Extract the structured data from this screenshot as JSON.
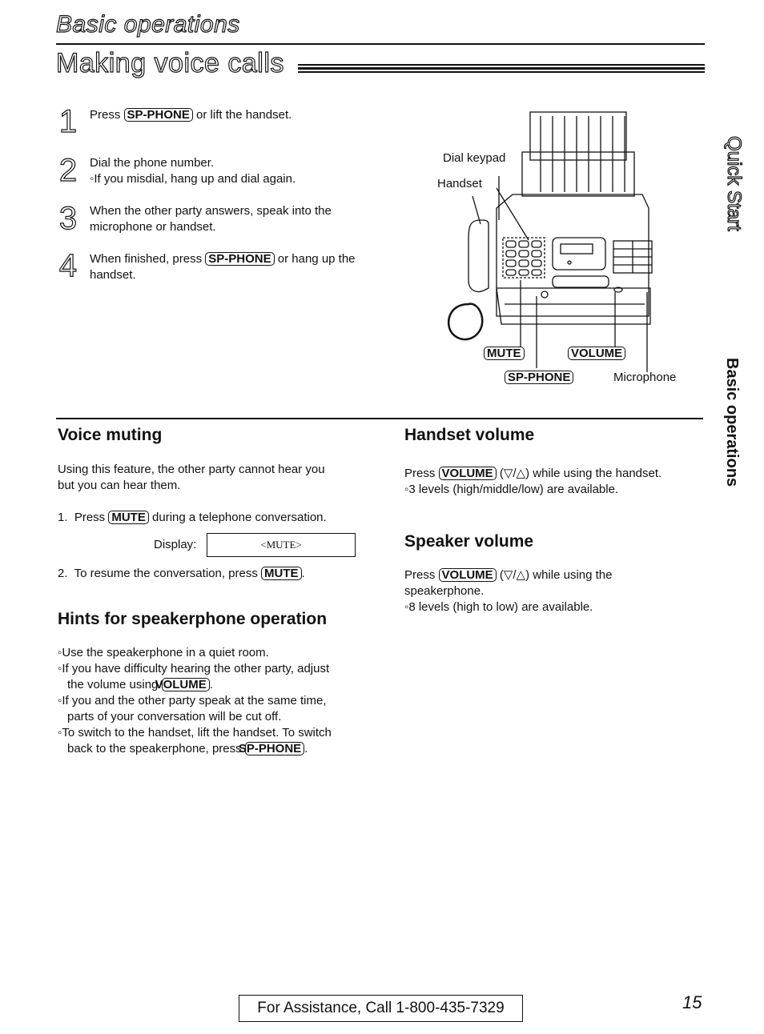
{
  "header": {
    "section_title": "Basic operations",
    "page_title": "Making voice calls"
  },
  "steps": [
    {
      "number": "1",
      "parts": [
        "Press ",
        "SP-PHONE",
        " or lift the handset."
      ]
    },
    {
      "number": "2",
      "line1": "Dial the phone number.",
      "line2": "◦If you misdial, hang up and dial again."
    },
    {
      "number": "3",
      "line1": "When the other party answers, speak into the",
      "line2": "microphone or handset."
    },
    {
      "number": "4",
      "parts": [
        "When finished, press ",
        "SP-PHONE",
        " or hang up the"
      ],
      "line2": "handset."
    }
  ],
  "diagram": {
    "labels": {
      "dial_keypad": "Dial keypad",
      "handset": "Handset",
      "mute": "MUTE",
      "volume": "VOLUME",
      "sp_phone": "SP-PHONE",
      "microphone": "Microphone"
    }
  },
  "side_tabs": {
    "quick_start": "Quick Start",
    "basic_operations": "Basic operations"
  },
  "voice_muting": {
    "heading": "Voice muting",
    "intro_line1": "Using this feature, the other party cannot hear you",
    "intro_line2": "but you can hear them.",
    "step1": [
      "1.  Press ",
      "MUTE",
      " during a telephone conversation."
    ],
    "display_label": "Display:",
    "display_value": "<MUTE>",
    "step2": [
      "2.  To resume the conversation, press ",
      "MUTE",
      "."
    ]
  },
  "hints": {
    "heading": "Hints for speakerphone operation",
    "items": [
      {
        "text": "◦Use the speakerphone in a quiet room."
      },
      {
        "text": "◦If you have difficulty hearing the other party, adjust the volume using ",
        "key": "VOLUME",
        "after": "."
      },
      {
        "text": "◦If you and the other party speak at the same time, parts of your conversation will be cut off."
      },
      {
        "text": "◦To switch to the handset, lift the handset. To switch back to the speakerphone, press ",
        "key": "SP-PHONE",
        "after": "."
      }
    ]
  },
  "handset_volume": {
    "heading": "Handset volume",
    "line1": [
      "Press ",
      "VOLUME",
      " (▽/△) while using the handset."
    ],
    "line2": "◦3 levels (high/middle/low) are available."
  },
  "speaker_volume": {
    "heading": "Speaker volume",
    "line1": [
      "Press ",
      "VOLUME",
      " (▽/△) while using the"
    ],
    "line1b": "speakerphone.",
    "line2": "◦8 levels (high to low) are available."
  },
  "footer": {
    "assistance": "For Assistance, Call 1-800-435-7329",
    "page_number": "15"
  }
}
